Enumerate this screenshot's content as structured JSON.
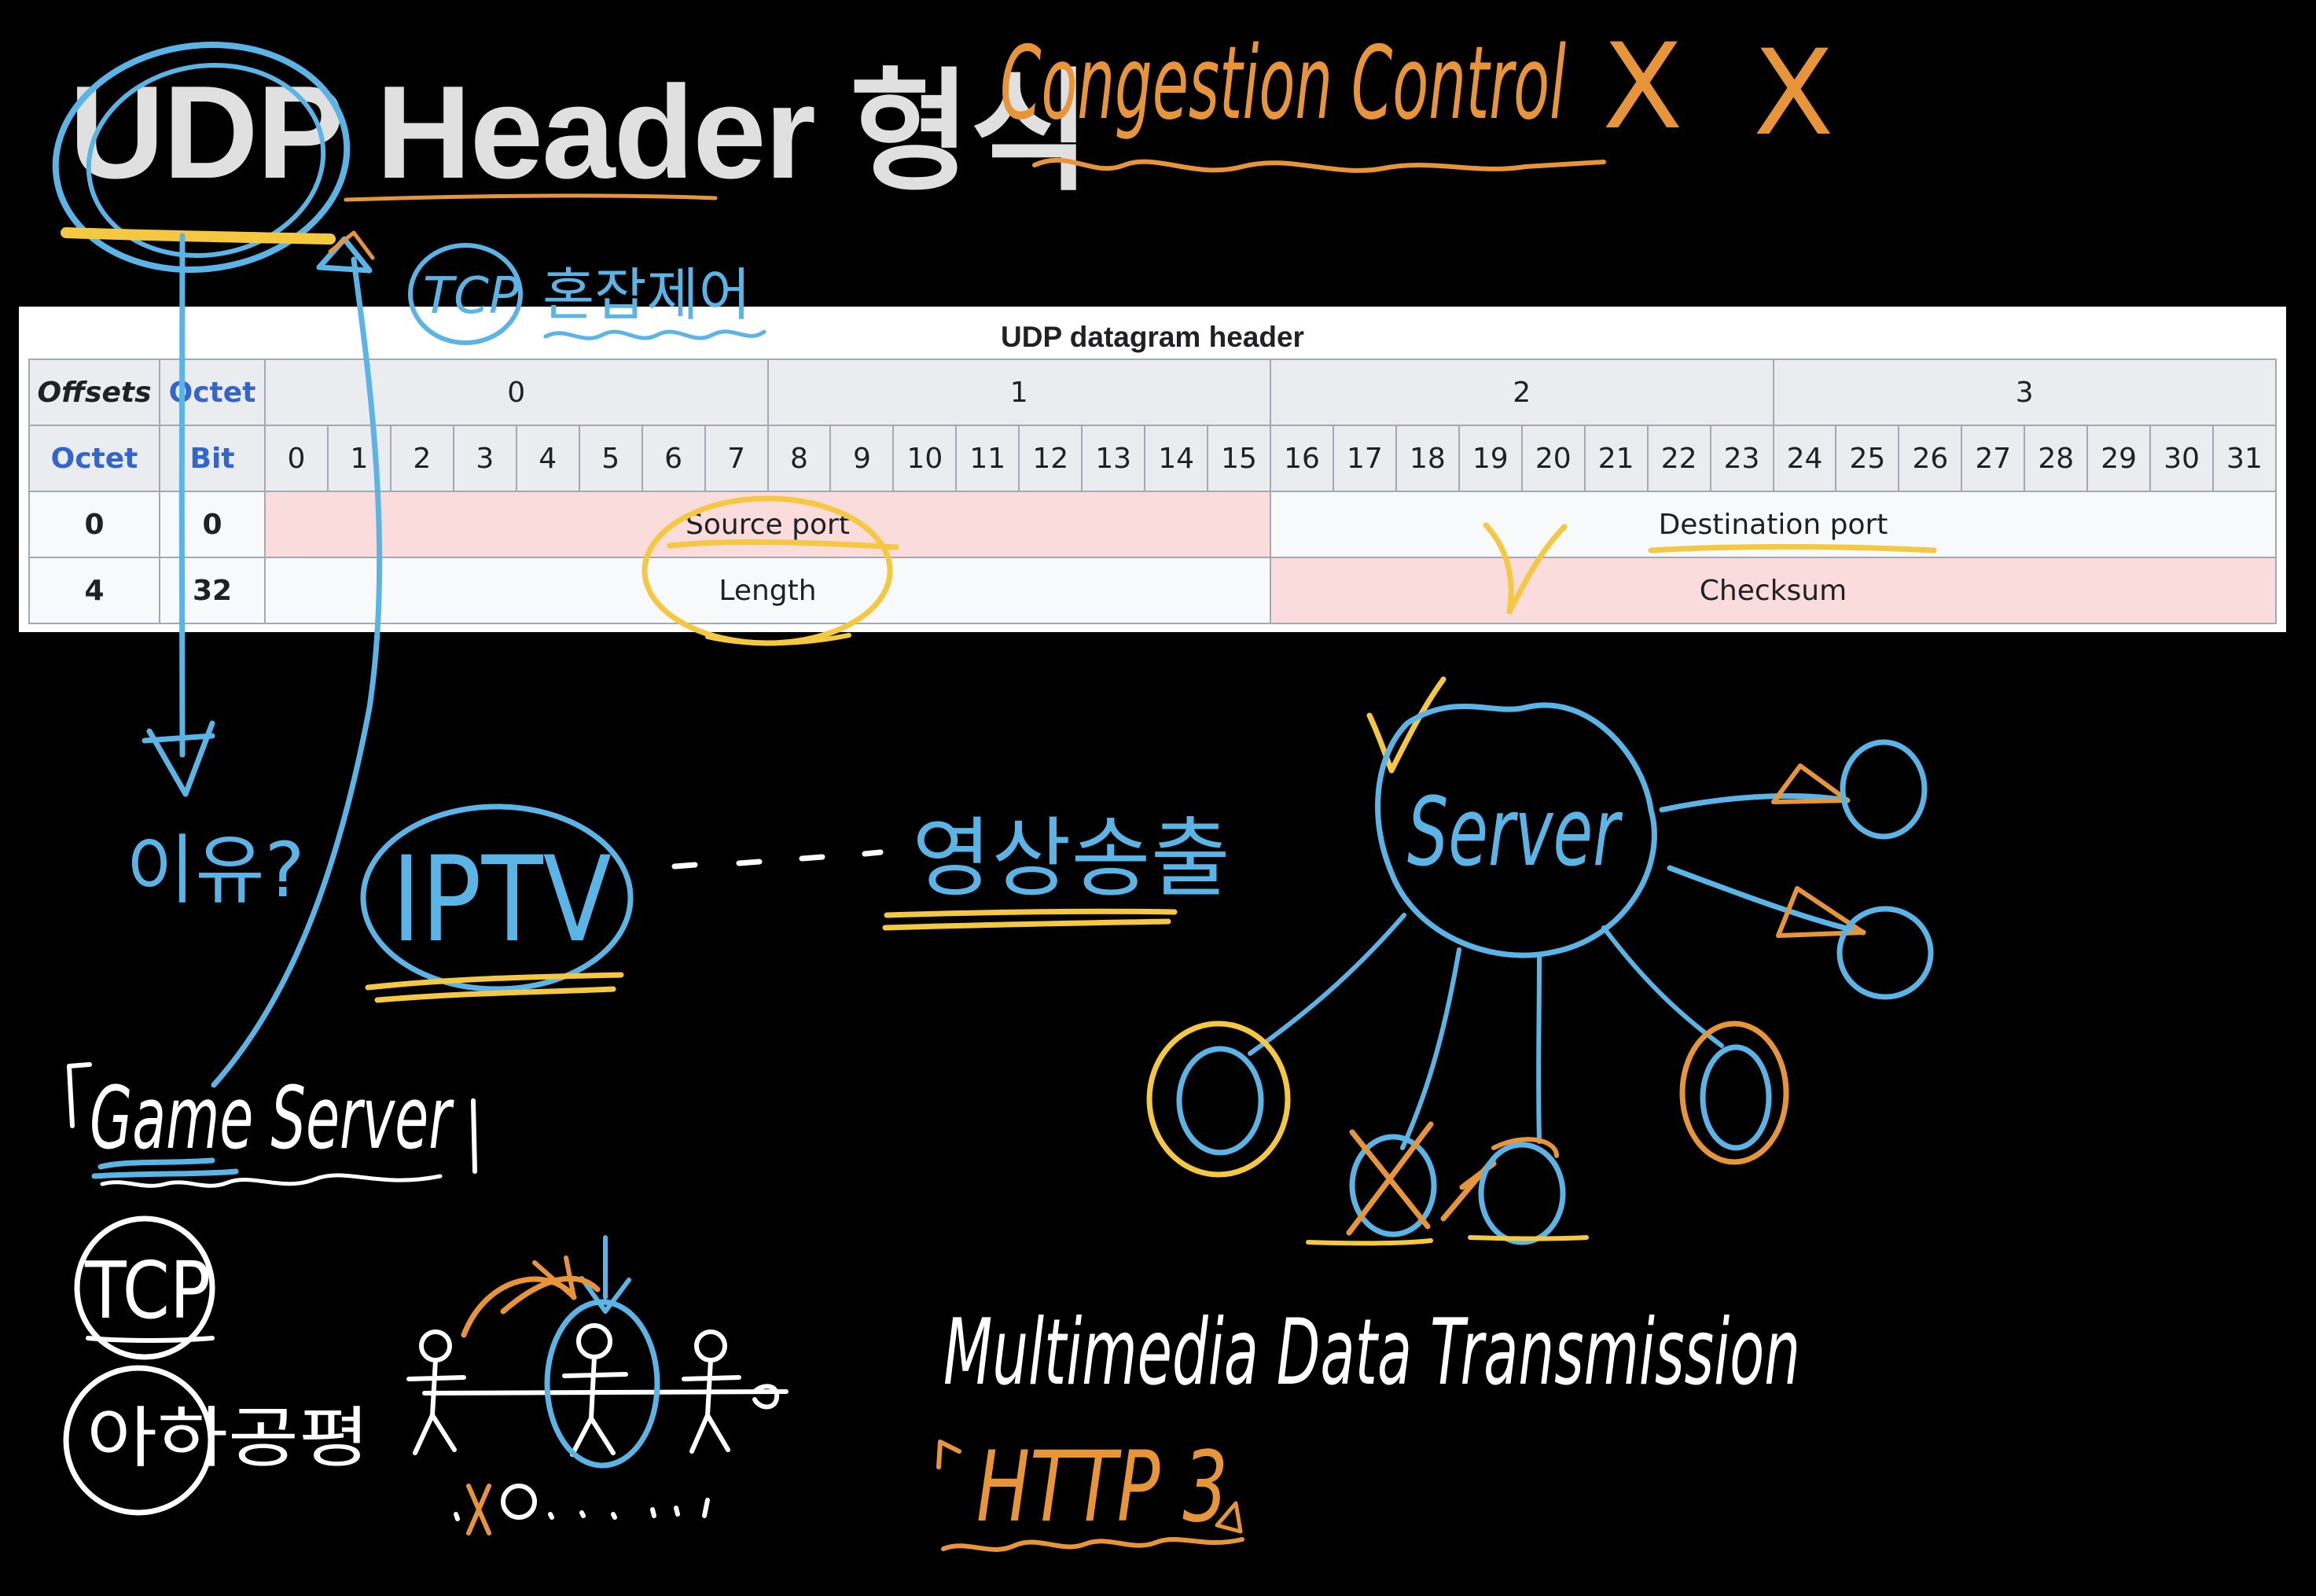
{
  "title": "UDP Header 형식",
  "table": {
    "caption": "UDP datagram header",
    "offsets_label": "Offsets",
    "octet_label": "Octet",
    "bit_label": "Bit",
    "octet_groups": [
      "0",
      "1",
      "2",
      "3"
    ],
    "bits": [
      "0",
      "1",
      "2",
      "3",
      "4",
      "5",
      "6",
      "7",
      "8",
      "9",
      "10",
      "11",
      "12",
      "13",
      "14",
      "15",
      "16",
      "17",
      "18",
      "19",
      "20",
      "21",
      "22",
      "23",
      "24",
      "25",
      "26",
      "27",
      "28",
      "29",
      "30",
      "31"
    ],
    "rows": [
      {
        "octet": "0",
        "bit": "0",
        "fields": [
          "Source port",
          "Destination port"
        ]
      },
      {
        "octet": "4",
        "bit": "32",
        "fields": [
          "Length",
          "Checksum"
        ]
      }
    ]
  },
  "annotations": {
    "congestion": "Congestion Control",
    "cross_1": "X",
    "cross_2": "X",
    "tcp_note": "TCP",
    "tcp_korean": "혼잡제어",
    "why": "이유?",
    "iptv": "IPTV",
    "streaming": "영상송출",
    "server": "Server",
    "game_server": "Game Server",
    "tcp_bottom": "TCP",
    "fairness": "아하공평",
    "multimedia": "Multimedia Data Transmission",
    "http3": "HTTP 3"
  },
  "colors": {
    "blue": "#5ab4e6",
    "orange": "#e8953a",
    "yellow": "#f5c842",
    "white": "#ffffff",
    "title": "#e0e0e0",
    "pink": "#fadcdc",
    "table_header": "#eaecf0",
    "link_blue": "#3366cc"
  }
}
